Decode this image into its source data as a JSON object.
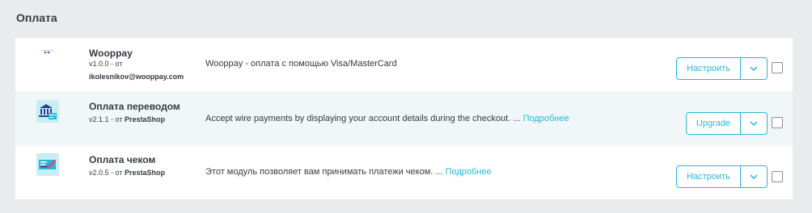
{
  "section": {
    "title": "Оплата"
  },
  "modules": [
    {
      "name": "Wooppay",
      "version": "v1.0.0 - от",
      "author": "ikolesnikov@wooppay.com",
      "description": "Wooppay - оплата с помощью Visa/MasterCard",
      "more": "",
      "action": "Настроить",
      "logo": "wooppay-logo"
    },
    {
      "name": "Оплата переводом",
      "version": "v2.1.1 - от",
      "author": "PrestaShop",
      "description": "Accept wire payments by displaying your account details during the checkout. ...",
      "more": "Подробнее",
      "action": "Upgrade",
      "logo": "bank-transfer-icon"
    },
    {
      "name": "Оплата чеком",
      "version": "v2.0.5 - от",
      "author": "PrestaShop",
      "description": "Этот модуль позволяет вам принимать платежи чеком. ...",
      "more": "Подробнее",
      "action": "Настроить",
      "logo": "check-payment-icon"
    }
  ],
  "colors": {
    "accent": "#25b9d7",
    "text": "#363a41",
    "background": "#eaebec"
  }
}
